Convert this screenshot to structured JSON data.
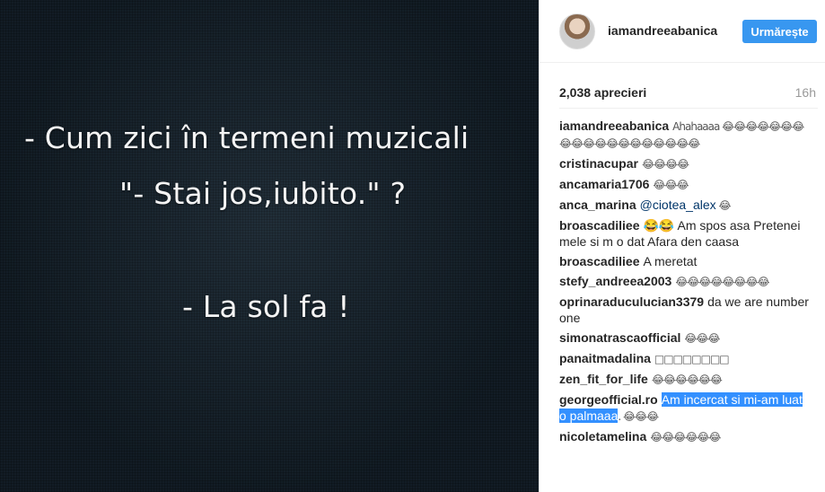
{
  "post_image": {
    "lines": [
      "- Cum zici în termeni muzicali",
      "\"- Stai jos,iubito.\" ?",
      "- La sol fa !"
    ]
  },
  "header": {
    "username": "iamandreeabanica",
    "follow_label": "Urmărește"
  },
  "stats": {
    "likes": "2,038 aprecieri",
    "time": "16h"
  },
  "comments": [
    {
      "user": "iamandreeabanica",
      "text": "Ahahaaaa 😂😂😂😂😂😂😂😂😂😂😂😂😂😂😂😂😂😂😂"
    },
    {
      "user": "cristinacupar",
      "text": "😂😂😂😂"
    },
    {
      "user": "ancamaria1706",
      "text": "😂😂😂"
    },
    {
      "user": "anca_marina",
      "mention": "@ciotea_alex",
      "text": " 😂"
    },
    {
      "user": "broascadiliee",
      "text": "😂😂 Am spos asa Pretenei mele si m o dat Afara den caasa"
    },
    {
      "user": "broascadiliee",
      "text": "A meretat"
    },
    {
      "user": "stefy_andreea2003",
      "text": "😂😂😂😂😂😂😂😂"
    },
    {
      "user": "oprinaraduculucian3379",
      "text": "da we are number one"
    },
    {
      "user": "simonatrascaofficial",
      "text": "😂😂😂"
    },
    {
      "user": "panaitmadalina",
      "text": "□□□□□□□□"
    },
    {
      "user": "zen_fit_for_life",
      "text": "😂😂😂😂😂😂"
    },
    {
      "user": "georgeofficial.ro",
      "highlight": "Am incercat si mi-am luat o palmaaa",
      "text": ". 😂😂😂"
    },
    {
      "user": "nicoletamelina",
      "text": "😂😂😂😂😂😂"
    }
  ]
}
